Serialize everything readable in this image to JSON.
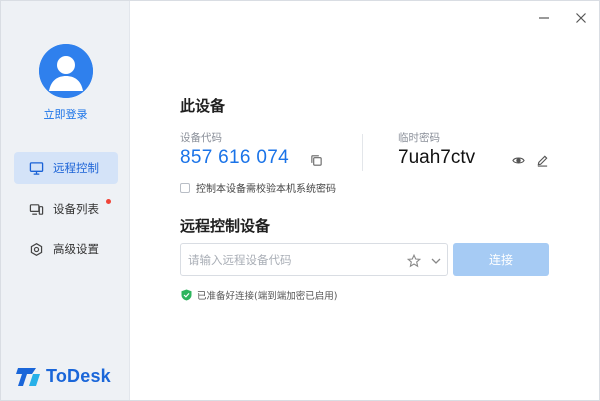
{
  "window": {
    "controls": {
      "minimize_icon": "minimize-icon",
      "close_icon": "close-icon"
    }
  },
  "sidebar": {
    "login_label": "立即登录",
    "items": [
      {
        "label": "远程控制",
        "icon": "monitor-icon",
        "active": true
      },
      {
        "label": "设备列表",
        "icon": "devices-icon",
        "badge": true
      },
      {
        "label": "高级设置",
        "icon": "settings-icon"
      }
    ],
    "brand": "ToDesk"
  },
  "this_device": {
    "title": "此设备",
    "code_label": "设备代码",
    "code_value": "857 616 074",
    "password_label": "临时密码",
    "password_value": "7uah7ctv",
    "checkbox_label": "控制本设备需校验本机系统密码",
    "checkbox_checked": false
  },
  "remote": {
    "title": "远程控制设备",
    "input_placeholder": "请输入远程设备代码",
    "input_value": "",
    "connect_label": "连接",
    "status_text": "已准备好连接(端到端加密已启用)"
  },
  "colors": {
    "accent": "#1a73e8",
    "sidebar_bg": "#eef1f5",
    "active_bg": "#d4e3f8",
    "connect_bg": "#a6cbf4",
    "status_ok": "#2db55d",
    "badge": "#f04438"
  }
}
